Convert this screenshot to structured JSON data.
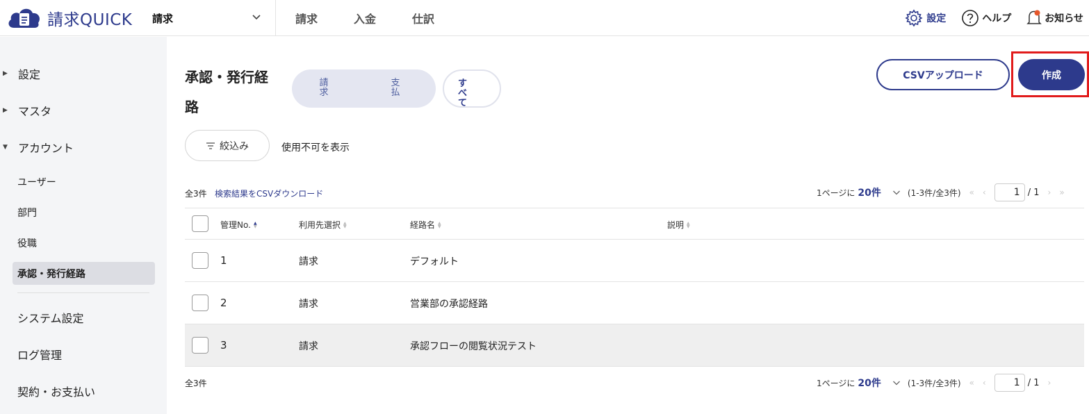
{
  "header": {
    "logo_text": "請求QUICK",
    "product": "請求",
    "nav": [
      "請求",
      "入金",
      "仕訳"
    ],
    "tools": {
      "settings": "設定",
      "help": "ヘルプ",
      "notifications": "お知らせ"
    }
  },
  "sidebar": {
    "groups": [
      {
        "label": "設定",
        "state": "collapsed"
      },
      {
        "label": "マスタ",
        "state": "collapsed"
      },
      {
        "label": "アカウント",
        "state": "expanded"
      }
    ],
    "account_items": [
      "ユーザー",
      "部門",
      "役職",
      "承認・発行経路"
    ],
    "active_item": "承認・発行経路",
    "other_items": [
      "システム設定",
      "ログ管理",
      "契約・お支払い"
    ]
  },
  "page": {
    "title": "承認・発行経路",
    "segment": {
      "billing": "請求",
      "payment": "支払",
      "all": "すべて"
    },
    "csv_upload": "CSVアップロード",
    "create": "作成",
    "filter": "絞込み",
    "show_disabled": "使用不可を表示"
  },
  "results": {
    "count": "全3件",
    "csv_download": "検索結果をCSVダウンロード",
    "pager": {
      "per_page_label": "1ページに",
      "per_page": "20件",
      "range": "(1-3件/全3件)",
      "page": "1",
      "total": "/ 1"
    }
  },
  "table": {
    "columns": [
      "管理No.",
      "利用先選択",
      "経路名",
      "説明"
    ],
    "rows": [
      {
        "no": "1",
        "target": "請求",
        "name": "デフォルト",
        "description": ""
      },
      {
        "no": "2",
        "target": "請求",
        "name": "営業部の承認経路",
        "description": ""
      },
      {
        "no": "3",
        "target": "請求",
        "name": "承認フローの閲覧状況テスト",
        "description": ""
      }
    ]
  },
  "colors": {
    "brand": "#2d3a8c",
    "highlight_box": "#e11b1b",
    "sidebar_bg": "#f4f5f7",
    "notification_dot": "#e5572b"
  },
  "icons": [
    "cloud-logo-icon",
    "chevron-down-icon",
    "gear-icon",
    "question-circle-icon",
    "bell-icon",
    "filter-icon",
    "sort-icon",
    "triangle-right-icon",
    "triangle-down-icon"
  ]
}
